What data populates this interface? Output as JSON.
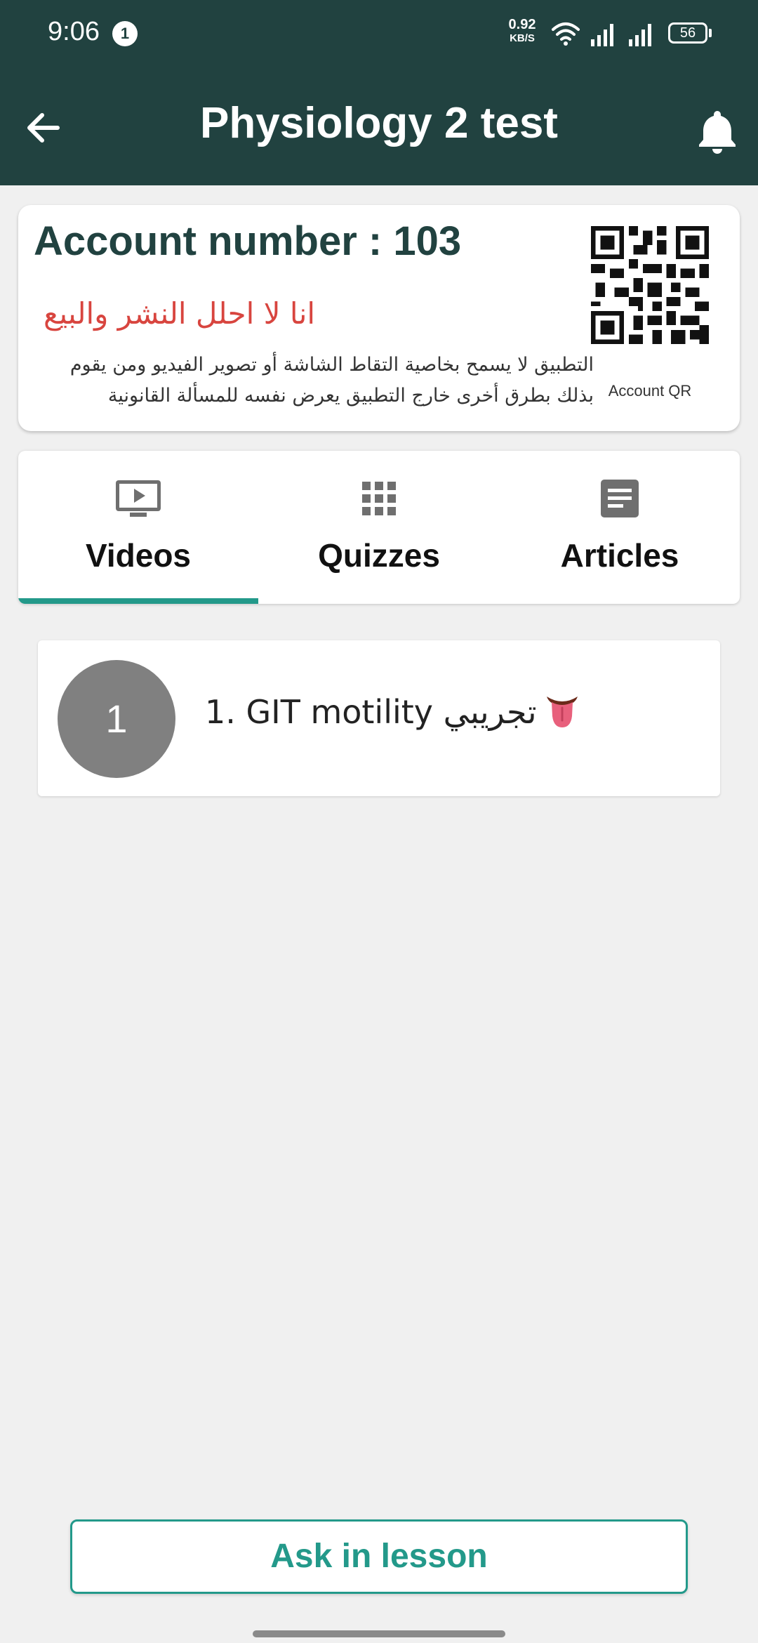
{
  "status_bar": {
    "time": "9:06",
    "notification_count": "1",
    "net_speed_value": "0.92",
    "net_speed_unit": "KB/S",
    "battery": "56"
  },
  "app_bar": {
    "title": "Physiology 2 test",
    "back_icon": "arrow-left-icon",
    "bell_icon": "bell-icon"
  },
  "account": {
    "number_text": "Account number : 103",
    "warning": "انا لا احلل النشر والبيع",
    "notice": "التطبيق لا يسمح بخاصية التقاط الشاشة أو تصوير الفيديو ومن يقوم بذلك بطرق أخرى خارج التطبيق يعرض نفسه للمسألة القانونية",
    "qr_label": "Account QR"
  },
  "tabs": [
    {
      "label": "Videos",
      "icon": "video-tv-icon",
      "selected": true
    },
    {
      "label": "Quizzes",
      "icon": "grid-icon",
      "selected": false
    },
    {
      "label": "Articles",
      "icon": "article-icon",
      "selected": false
    }
  ],
  "lessons": [
    {
      "number": "1",
      "title": "1. GIT motility تجريبي"
    }
  ],
  "ask_button_label": "Ask in lesson",
  "colors": {
    "primary": "#214240",
    "accent": "#23998a",
    "warning": "#d8453f"
  }
}
